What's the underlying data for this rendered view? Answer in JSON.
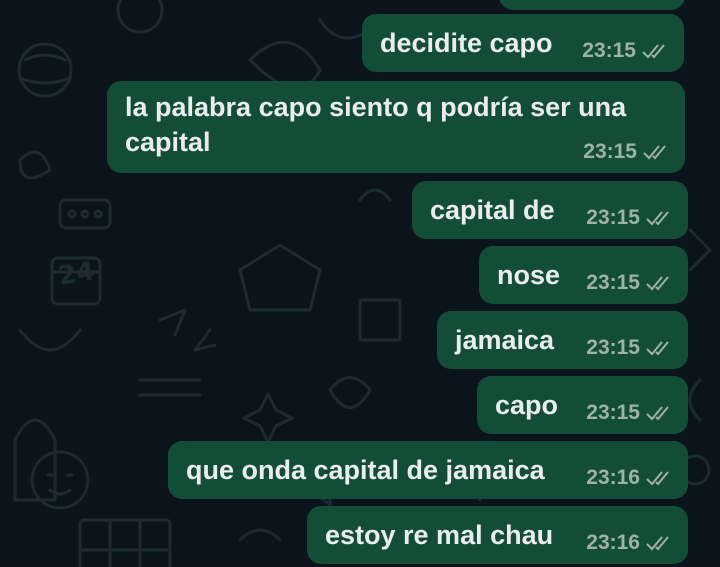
{
  "colors": {
    "background": "#0b141a",
    "outgoing_bubble": "#144d37",
    "message_text": "#e9edef",
    "timestamp": "#9db2a8",
    "ticks": "#9db2a8"
  },
  "messages": [
    {
      "text": "decidite capo",
      "time": "23:15",
      "status_icon": "double-check-icon"
    },
    {
      "text_line1": "la palabra capo siento q podría ser una",
      "text_line2": "capital",
      "time": "23:15",
      "status_icon": "double-check-icon"
    },
    {
      "text": "capital de",
      "time": "23:15",
      "status_icon": "double-check-icon"
    },
    {
      "text": "nose",
      "time": "23:15",
      "status_icon": "double-check-icon"
    },
    {
      "text": "jamaica",
      "time": "23:15",
      "status_icon": "double-check-icon"
    },
    {
      "text": "capo",
      "time": "23:15",
      "status_icon": "double-check-icon"
    },
    {
      "text": "que onda capital de jamaica",
      "time": "23:16",
      "status_icon": "double-check-icon"
    },
    {
      "text": "estoy re mal chau",
      "time": "23:16",
      "status_icon": "double-check-icon"
    }
  ]
}
